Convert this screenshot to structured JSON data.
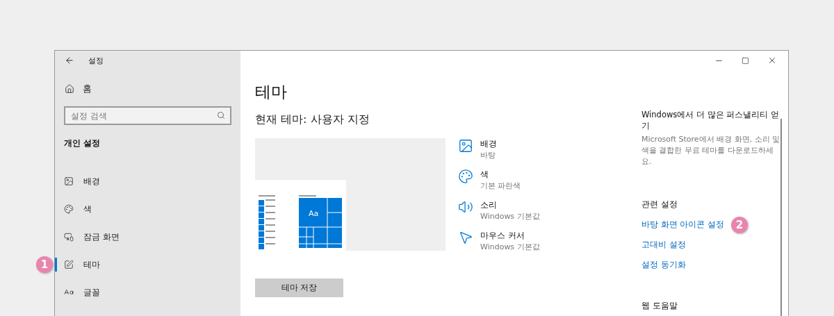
{
  "window": {
    "title": "설정"
  },
  "sidebar": {
    "home": "홈",
    "search": {
      "placeholder": "설정 검색"
    },
    "section": "개인 설정",
    "items": [
      {
        "label": "배경",
        "selected": false
      },
      {
        "label": "색",
        "selected": false
      },
      {
        "label": "잠금 화면",
        "selected": false
      },
      {
        "label": "테마",
        "selected": true,
        "callout": "1"
      },
      {
        "label": "글꼴",
        "selected": false
      }
    ]
  },
  "main": {
    "title": "테마",
    "current_theme": "현재 테마: 사용자 지정",
    "attributes": [
      {
        "title": "배경",
        "value": "바탕"
      },
      {
        "title": "색",
        "value": "기본 파란색"
      },
      {
        "title": "소리",
        "value": "Windows 기본값"
      },
      {
        "title": "마우스 커서",
        "value": "Windows 기본값"
      }
    ],
    "preview_tile": "Aa",
    "save_button": "테마 저장"
  },
  "aside": {
    "heading": "Windows에서 더 많은 퍼스낼리티 얻기",
    "description": "Microsoft Store에서 배경 화면, 소리 및 색을 결합한 무료 테마를 다운로드하세요.",
    "related_heading": "관련 설정",
    "links": [
      {
        "label": "바탕 화면 아이콘 설정",
        "callout": "2"
      },
      {
        "label": "고대비 설정"
      },
      {
        "label": "설정 동기화"
      }
    ],
    "help_heading": "웹 도움말"
  }
}
